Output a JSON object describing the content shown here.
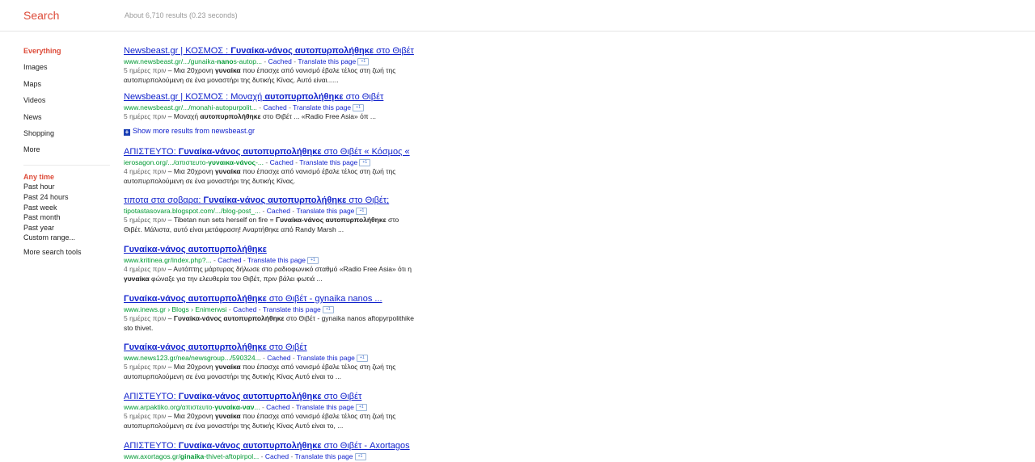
{
  "header": {
    "title": "Search",
    "result_stats": "About 6,710 results (0.23 seconds)"
  },
  "leftnav": {
    "items": [
      "Everything",
      "Images",
      "Maps",
      "Videos",
      "News",
      "Shopping",
      "More"
    ],
    "time": [
      "Any time",
      "Past hour",
      "Past 24 hours",
      "Past week",
      "Past month",
      "Past year",
      "Custom range..."
    ],
    "more_tools": "More search tools"
  },
  "links": {
    "cached": "Cached",
    "translate": "Translate this page",
    "plus_one": "+1",
    "sep": " - "
  },
  "more_results": {
    "icon": "+",
    "text": "Show more results from newsbeast.gr"
  },
  "results": [
    {
      "title": [
        "Newsbeast.gr | ΚΟΣΜΟΣ : ",
        "Γυναίκα-νάνος αυτοπυρπολήθηκε",
        " στο Θιβέτ"
      ],
      "url": [
        "www.newsbeast.gr/.../gunaika-",
        "nano",
        "s-autop..."
      ],
      "date": "5 ημέρες πριν",
      "snippet": [
        " – Μια 20χρονη ",
        "γυναίκα",
        " που έπασχε από νανισμό έβαλε τέλος στη ζωή της αυτοπυρπολούμενη σε ένα μοναστήρι της δυτικής Κίνας. Αυτό είναι......"
      ]
    },
    {
      "title": [
        "Newsbeast.gr | ΚΟΣΜΟΣ : Μοναχή ",
        "αυτοπυρπολήθηκε",
        " στο Θιβέτ"
      ],
      "url": [
        "www.newsbeast.gr/.../monahi-autopurpolit...",
        "",
        ""
      ],
      "date": "5 ημέρες πριν",
      "snippet": [
        " – Μοναχή ",
        "αυτοπυρπολήθηκε",
        " στο Θιβέτ ... «Radio Free Asia» όπ ..."
      ]
    },
    {
      "title": [
        "ΑΠΙΣΤΕΥΤΟ: ",
        "Γυναίκα-νάνος αυτοπυρπολήθηκε",
        " στο Θιβέτ « Κόσμος «"
      ],
      "url": [
        "ierosagon.org/.../απιστευτο-",
        "γυναικα-νάνος",
        "-..."
      ],
      "date": "4 ημέρες πριν",
      "snippet": [
        " – Μια 20χρονη ",
        "γυναίκα",
        " που έπασχε από νανισμό έβαλε τέλος στη ζωή της αυτοπυρπολούμενη σε ένα μοναστήρι της δυτικής Κίνας."
      ]
    },
    {
      "title": [
        "τιποτα στα σοβαρα: ",
        "Γυναίκα-νάνος αυτοπυρπολήθηκε",
        " στο Θιβέτ;"
      ],
      "url": [
        "tipotastasovara.blogspot.com/.../blog-post_...",
        "",
        ""
      ],
      "date": "5 ημέρες πριν",
      "snippet": [
        " – Tibetan nun sets herself on fire = ",
        "Γυναίκα-νάνος αυτοπυρπολήθηκε",
        " στο Θιβέτ. Μάλιστα, αυτό είναι μετάφραση! Αναρτήθηκε από Randy Marsh ..."
      ]
    },
    {
      "title": [
        "",
        "Γυναίκα-νάνος αυτοπυρπολήθηκε",
        ""
      ],
      "url": [
        "www.kritinea.gr/index.php?...",
        "",
        ""
      ],
      "date": "4 ημέρες πριν",
      "snippet": [
        " – Αυτόπτης μάρτυρας δήλωσε στο ραδιοφωνικό σταθμό «Radio Free Asia» ότι η ",
        "γυναίκα",
        " φώναξε για την ελευθερία του Θιβέτ, πριν βάλει φωτιά ..."
      ]
    },
    {
      "title": [
        "",
        "Γυναίκα-νάνος αυτοπυρπολήθηκε",
        " στο Θιβέτ - gynaika nanos ..."
      ],
      "url": [
        "www.inews.gr › Blogs › Enimerwsi",
        "",
        ""
      ],
      "date": "5 ημέρες πριν",
      "snippet": [
        " – ",
        "Γυναίκα-νάνος αυτοπυρπολήθηκε",
        " στο Θιβέτ - gynaika nanos aftopyrpolithike sto thivet."
      ]
    },
    {
      "title": [
        "",
        "Γυναίκα-νάνος αυτοπυρπολήθηκε",
        " στο Θιβέτ"
      ],
      "url": [
        "www.news123.gr/nea/newsgroup.../590324...",
        "",
        ""
      ],
      "date": "5 ημέρες πριν",
      "snippet": [
        " – Μια 20χρονη ",
        "γυναίκα",
        " που έπασχε από νανισμό έβαλε τέλος στη ζωή της αυτοπυρπολούμενη σε ένα μοναστήρι της δυτικής Κίνας Αυτό είναι το ..."
      ]
    },
    {
      "title": [
        "ΑΠΙΣΤΕΥΤΟ: ",
        "Γυναίκα-νάνος αυτοπυρπολήθηκε",
        " στο Θιβέτ"
      ],
      "url": [
        "www.arpaktiko.org/απιστευτο-",
        "γυναίκα-ναν",
        "..."
      ],
      "date": "5 ημέρες πριν",
      "snippet": [
        " – Μια 20χρονη ",
        "γυναίκα",
        " που έπασχε από νανισμό έβαλε τέλος στη ζωή της αυτοπυρπολούμενη σε ένα μοναστήρι της δυτικής Κίνας Αυτό είναι το, ..."
      ]
    },
    {
      "title": [
        "ΑΠΙΣΤΕΥΤΟ: ",
        "Γυναίκα-νάνος αυτοπυρπολήθηκε",
        " στο Θιβέτ - Axortagos"
      ],
      "url": [
        "www.axortagos.gr/",
        "ginaika",
        "-thivet-aftopirpol..."
      ],
      "date": "",
      "snippet": [
        "",
        "",
        ""
      ]
    }
  ]
}
